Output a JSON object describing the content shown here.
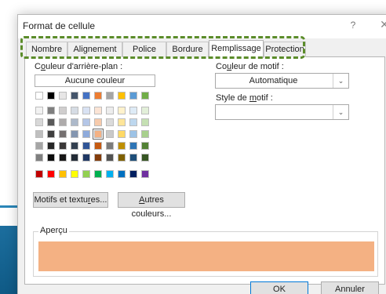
{
  "dialog": {
    "title": "Format de cellule",
    "help_glyph": "?",
    "close_glyph": "✕"
  },
  "tabs": [
    {
      "label": "Nombre",
      "active": false
    },
    {
      "label": "Alignement",
      "active": false
    },
    {
      "label": "Police",
      "active": false
    },
    {
      "label": "Bordure",
      "active": false
    },
    {
      "label": "Remplissage",
      "active": true
    },
    {
      "label": "Protection",
      "active": false
    }
  ],
  "fill": {
    "background_label_pre": "C",
    "background_label_u": "o",
    "background_label_post": "uleur d'arrière-plan :",
    "no_color_label": "Aucune couleur",
    "theme_top_row": [
      "#ffffff",
      "#000000",
      "#e7e6e6",
      "#44546a",
      "#4472c4",
      "#ed7d31",
      "#a5a5a5",
      "#ffc000",
      "#5b9bd5",
      "#70ad47"
    ],
    "theme_grid": [
      [
        "#f2f2f2",
        "#7f7f7f",
        "#d0cece",
        "#d6dce4",
        "#d9e2f3",
        "#fbe4d5",
        "#ededed",
        "#fff2cc",
        "#deebf6",
        "#e2efd9"
      ],
      [
        "#d8d8d8",
        "#595959",
        "#aeabab",
        "#adb9ca",
        "#b4c6e7",
        "#f7cbac",
        "#dbdbdb",
        "#fee599",
        "#bdd7ee",
        "#c5e0b3"
      ],
      [
        "#bfbfbf",
        "#3f3f3f",
        "#757070",
        "#8496b0",
        "#8eaadb",
        "#f4b183",
        "#c9c9c9",
        "#ffd965",
        "#9dc3e6",
        "#a8d08d"
      ],
      [
        "#a5a5a5",
        "#262626",
        "#3a3838",
        "#323f4f",
        "#2f5496",
        "#c55a11",
        "#7b7b7b",
        "#bf8f00",
        "#2e75b5",
        "#538135"
      ],
      [
        "#7f7f7f",
        "#0c0c0c",
        "#171616",
        "#222a35",
        "#1f3864",
        "#833c0b",
        "#525252",
        "#7f6000",
        "#1e4e79",
        "#375623"
      ]
    ],
    "standard_row": [
      "#c00000",
      "#ff0000",
      "#ffc000",
      "#ffff00",
      "#92d050",
      "#00b050",
      "#00b0f0",
      "#0070c0",
      "#002060",
      "#7030a0"
    ],
    "selected_cell": {
      "row": 2,
      "col": 5
    },
    "patterns_button_pre": "Motifs et textu",
    "patterns_button_u": "r",
    "patterns_button_post": "es...",
    "more_colors_button_pre": "",
    "more_colors_button_u": "A",
    "more_colors_button_post": "utres couleurs..."
  },
  "pattern": {
    "color_label_pre": "Co",
    "color_label_u": "u",
    "color_label_post": "leur de motif :",
    "color_value": "Automatique",
    "style_label_pre": "Style de ",
    "style_label_u": "m",
    "style_label_post": "otif :",
    "style_value": ""
  },
  "preview": {
    "label": "Aperçu",
    "color": "#f4b183"
  },
  "footer": {
    "ok_label": "OK",
    "cancel_label": "Annuler"
  },
  "colors": {
    "highlight_dash": "#5b8c2a",
    "accent_blue": "#0078d7"
  }
}
